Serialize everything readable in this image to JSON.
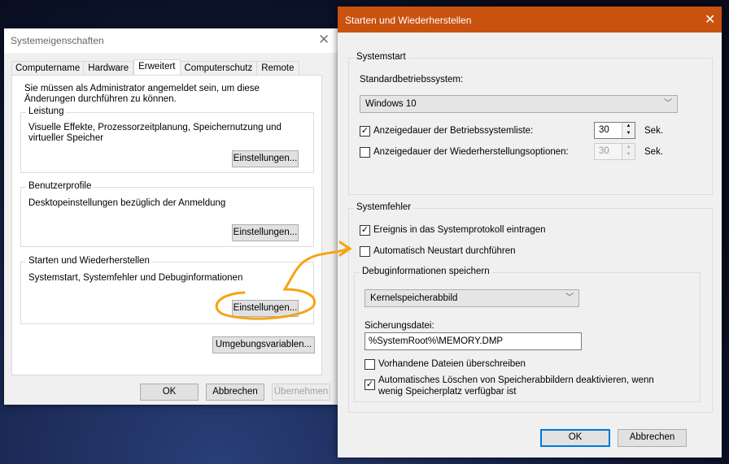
{
  "sys": {
    "title": "Systemeigenschaften",
    "tabs": [
      "Computername",
      "Hardware",
      "Erweitert",
      "Computerschutz",
      "Remote"
    ],
    "admin_note": "Sie müssen als Administrator angemeldet sein, um diese Änderungen durchführen zu können.",
    "groups": [
      {
        "title": "Leistung",
        "text": "Visuelle Effekte, Prozessorzeitplanung, Speichernutzung und virtueller Speicher",
        "button": "Einstellungen..."
      },
      {
        "title": "Benutzerprofile",
        "text": "Desktopeinstellungen bezüglich der Anmeldung",
        "button": "Einstellungen..."
      },
      {
        "title": "Starten und Wiederherstellen",
        "text": "Systemstart, Systemfehler und Debuginformationen",
        "button": "Einstellungen..."
      }
    ],
    "env_button": "Umgebungsvariablen...",
    "ok": "OK",
    "cancel": "Abbrechen",
    "apply": "Übernehmen"
  },
  "sr": {
    "title": "Starten und Wiederherstellen",
    "startup": {
      "title": "Systemstart",
      "os_label": "Standardbetriebssystem:",
      "os_value": "Windows 10",
      "list_label": "Anzeigedauer der Betriebssystemliste:",
      "list_checked": true,
      "list_value": "30",
      "recovery_label": "Anzeigedauer der Wiederherstellungsoptionen:",
      "recovery_checked": false,
      "recovery_value": "30",
      "unit": "Sek."
    },
    "failure": {
      "title": "Systemfehler",
      "log_label": "Ereignis in das Systemprotokoll eintragen",
      "log_checked": true,
      "restart_label": "Automatisch Neustart durchführen",
      "restart_checked": false,
      "debug": {
        "title": "Debuginformationen speichern",
        "type": "Kernelspeicherabbild",
        "file_label": "Sicherungsdatei:",
        "file_value": "%SystemRoot%\\MEMORY.DMP",
        "overwrite_label": "Vorhandene Dateien überschreiben",
        "overwrite_checked": false,
        "autodelete_label": "Automatisches Löschen von Speicherabbildern deaktivieren, wenn wenig Speicherplatz verfügbar ist",
        "autodelete_checked": true
      }
    },
    "ok": "OK",
    "cancel": "Abbrechen"
  },
  "colors": {
    "titlebar": "#c9520f",
    "annotation": "#f5a412",
    "focus": "#0078d7"
  }
}
